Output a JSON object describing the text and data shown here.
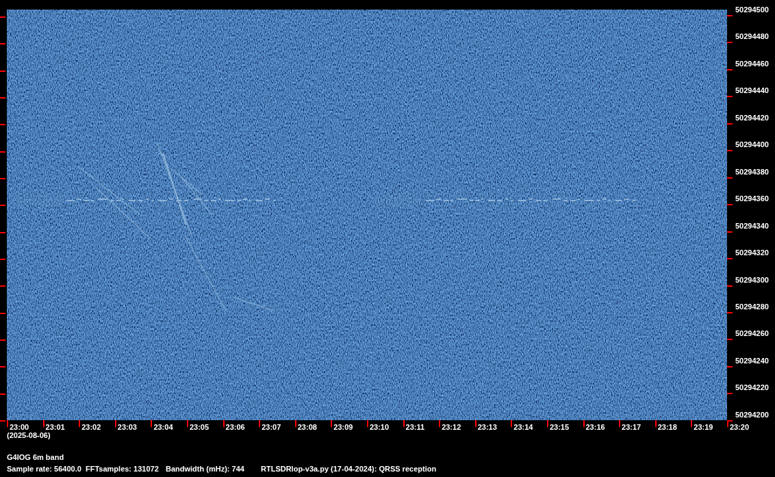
{
  "frequency_axis": {
    "ticks": [
      "50294500",
      "50294480",
      "50294460",
      "50294440",
      "50294420",
      "50294400",
      "50294380",
      "50294360",
      "50294340",
      "50294320",
      "50294300",
      "50294280",
      "50294260",
      "50294240",
      "50294220",
      "50294200"
    ]
  },
  "time_axis": {
    "ticks": [
      "23:00",
      "23:01",
      "23:02",
      "23:03",
      "23:04",
      "23:05",
      "23:06",
      "23:07",
      "23:08",
      "23:09",
      "23:10",
      "23:11",
      "23:12",
      "23:13",
      "23:14",
      "23:15",
      "23:16",
      "23:17",
      "23:18",
      "23:19",
      "23:20"
    ],
    "date": "(2025-08-06)"
  },
  "info": {
    "title": "G4IOG 6m band",
    "fields": [
      "Sample rate: 56400.0",
      "FFTsamples: 131072",
      "Bandwidth (mHz): 744",
      "RTLSDRlop-v3a.py (17-04-2024): QRSS reception"
    ]
  }
}
